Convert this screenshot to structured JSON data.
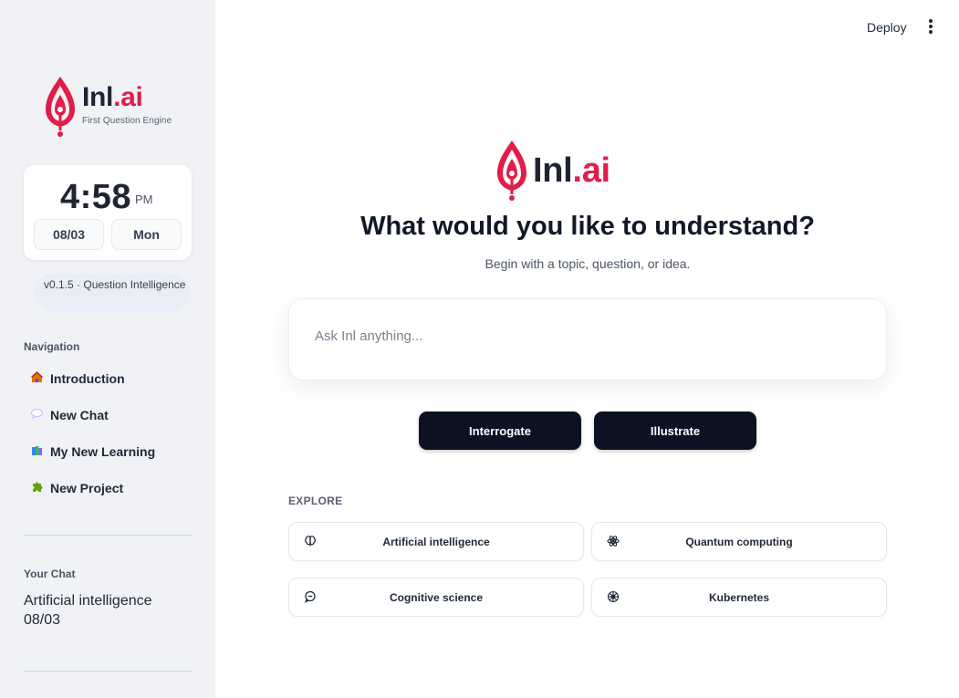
{
  "app": {
    "brand_name_main": "Inl",
    "brand_name_accent": ".ai",
    "brand_tagline": "First Question Engine",
    "accent_color": "#e11d48",
    "dark_color": "#0c1222"
  },
  "sidebar": {
    "clock": {
      "time": "4:58",
      "ampm": "PM",
      "date": "08/03",
      "day": "Mon"
    },
    "version": "v0.1.5 · Question Intelligence",
    "nav_title": "Navigation",
    "nav_items": [
      {
        "icon": "house-icon",
        "label": "Introduction"
      },
      {
        "icon": "speech-bubble-icon",
        "label": "New Chat"
      },
      {
        "icon": "books-icon",
        "label": "My New Learning"
      },
      {
        "icon": "puzzle-icon",
        "label": "New Project"
      }
    ],
    "chat_title": "Your Chat",
    "chats": [
      {
        "title": "Artificial intelligence",
        "date": "08/03"
      }
    ]
  },
  "topbar": {
    "deploy_label": "Deploy",
    "menu_icon": "kebab-menu-icon"
  },
  "main": {
    "brand_name_main": "Inl",
    "brand_name_accent": ".ai",
    "headline": "What would you like to understand?",
    "subheadline": "Begin with a topic, question, or idea.",
    "ask_placeholder": "Ask Inl anything...",
    "actions": {
      "interrogate": "Interrogate",
      "illustrate": "Illustrate"
    },
    "explore_title": "EXPLORE",
    "explore_items": [
      {
        "icon": "brain-icon",
        "label": "Artificial intelligence"
      },
      {
        "icon": "atom-icon",
        "label": "Quantum computing"
      },
      {
        "icon": "chat-bubble-icon",
        "label": "Cognitive science"
      },
      {
        "icon": "helm-wheel-icon",
        "label": "Kubernetes"
      }
    ]
  }
}
